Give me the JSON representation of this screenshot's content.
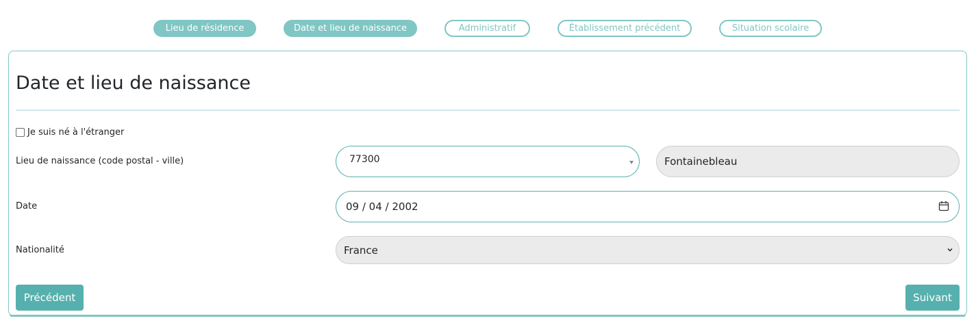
{
  "steps": [
    {
      "label": "Lieu de résidence",
      "state": "done"
    },
    {
      "label": "Date et lieu de naissance",
      "state": "done"
    },
    {
      "label": "Administratif",
      "state": "todo"
    },
    {
      "label": "Établissement précédent",
      "state": "todo"
    },
    {
      "label": "Situation scolaire",
      "state": "todo"
    }
  ],
  "form": {
    "title": "Date et lieu de naissance",
    "foreign_born_label": "Je suis né à l'étranger",
    "foreign_born_checked": false,
    "birthplace": {
      "label": "Lieu de naissance (code postal - ville)",
      "postal_code": "77300",
      "city": "Fontainebleau"
    },
    "date": {
      "label": "Date",
      "value": "09 / 04 / 2002"
    },
    "nationality": {
      "label": "Nationalité",
      "value": "France"
    }
  },
  "buttons": {
    "previous": "Précédent",
    "next": "Suivant"
  },
  "colors": {
    "accent": "#7fc6c4",
    "button": "#56b0ad"
  },
  "icons": {
    "date": "calendar-icon",
    "nationality": "chevron-down-icon",
    "postal_code": "caret-down-icon"
  }
}
